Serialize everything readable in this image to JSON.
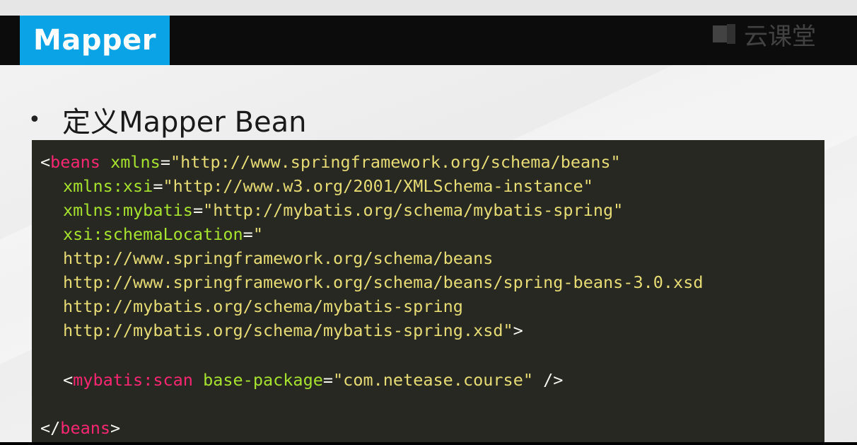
{
  "slide": {
    "title": "Mapper",
    "watermark": "云课堂",
    "bullet": "•",
    "heading": "定义Mapper Bean"
  },
  "code": {
    "line1": {
      "lt": "<",
      "tag": "beans",
      "sp": " ",
      "attr": "xmlns",
      "eq": "=",
      "value": "\"http://www.springframework.org/schema/beans\""
    },
    "line2": {
      "attr": "xmlns:xsi",
      "eq": "=",
      "value": "\"http://www.w3.org/2001/XMLSchema-instance\""
    },
    "line3": {
      "attr": "xmlns:mybatis",
      "eq": "=",
      "value": "\"http://mybatis.org/schema/mybatis-spring\""
    },
    "line4": {
      "attr": "xsi:schemaLocation",
      "eq": "=",
      "value": "\""
    },
    "line5": {
      "value": "http://www.springframework.org/schema/beans"
    },
    "line6": {
      "value": "http://www.springframework.org/schema/beans/spring-beans-3.0.xsd"
    },
    "line7": {
      "value": "http://mybatis.org/schema/mybatis-spring"
    },
    "line8": {
      "value": "http://mybatis.org/schema/mybatis-spring.xsd\"",
      "gt": ">"
    },
    "line9": {
      "lt": "<",
      "tag": "mybatis:scan",
      "sp": " ",
      "attr": "base-package",
      "eq": "=",
      "value": "\"com.netease.course\"",
      "close": " />"
    },
    "line10": {
      "lt": "</",
      "tag": "beans",
      "gt": ">"
    }
  },
  "colors": {
    "accent": "#0aa3e6",
    "header": "#0c0c0c",
    "code_bg": "#272822",
    "code_tag": "#f92672",
    "code_attr": "#a6e22e",
    "code_string": "#e6db74",
    "code_text": "#f8f8f2"
  }
}
